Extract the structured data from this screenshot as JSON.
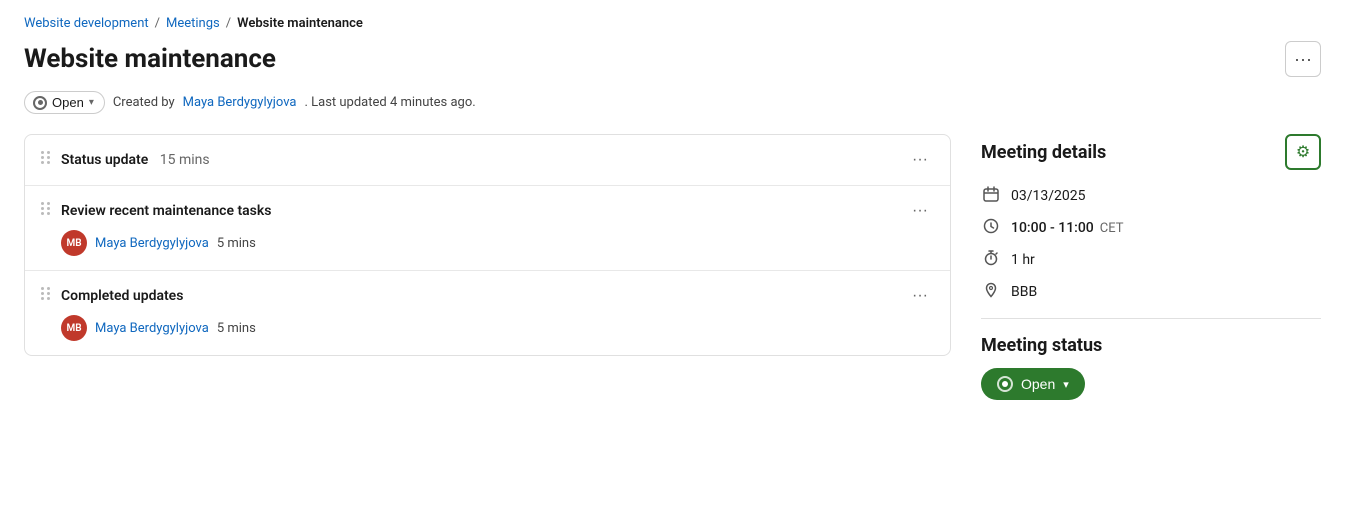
{
  "breadcrumb": {
    "link1": {
      "label": "Website development",
      "href": "#"
    },
    "link2": {
      "label": "Meetings",
      "href": "#"
    },
    "current": "Website maintenance",
    "sep": "/"
  },
  "page": {
    "title": "Website maintenance",
    "more_btn_label": "···"
  },
  "status_bar": {
    "open_label": "Open",
    "chevron": "▾",
    "created_by_text": "Created by",
    "author": "Maya Berdygylyjova",
    "updated_text": ". Last updated 4 minutes ago."
  },
  "agenda": {
    "items": [
      {
        "id": 1,
        "title": "Status update",
        "duration": "15 mins",
        "has_presenter": false
      },
      {
        "id": 2,
        "title": "Review recent maintenance tasks",
        "duration": null,
        "has_presenter": true,
        "presenter": "Maya Berdygylyjova",
        "presenter_duration": "5 mins",
        "avatar_initials": "MB"
      },
      {
        "id": 3,
        "title": "Completed updates",
        "duration": null,
        "has_presenter": true,
        "presenter": "Maya Berdygylyjova",
        "presenter_duration": "5 mins",
        "avatar_initials": "MB"
      }
    ]
  },
  "meeting_details": {
    "section_title": "Meeting details",
    "date": "03/13/2025",
    "time_range": "10:00 - 11:00",
    "timezone": "CET",
    "duration": "1 hr",
    "location": "BBB"
  },
  "meeting_status": {
    "section_title": "Meeting status",
    "status_label": "Open",
    "chevron": "▾"
  },
  "icons": {
    "calendar": "📅",
    "clock": "🕐",
    "stopwatch": "⏱",
    "location": "📍",
    "settings": "⚙",
    "more": "···"
  }
}
